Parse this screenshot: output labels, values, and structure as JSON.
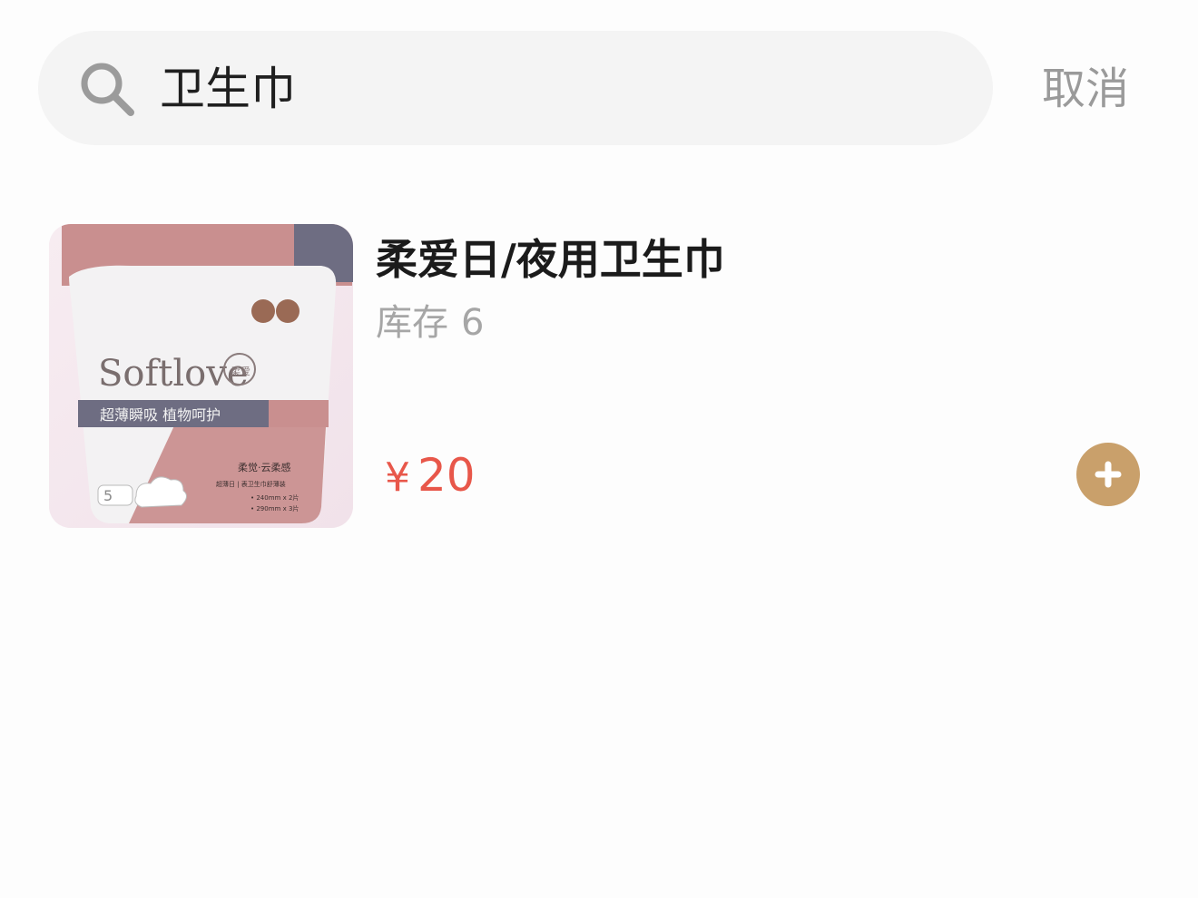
{
  "search": {
    "value": "卫生巾",
    "cancel_label": "取消"
  },
  "product": {
    "name": "柔爱日/夜用卫生巾",
    "stock_label": "库存",
    "stock_value": "6",
    "currency": "¥",
    "price": "20",
    "image_texts": {
      "brand": "Softlove",
      "brand_badge": "柔爱",
      "slogan": "超薄瞬吸 植物呵护",
      "line_name": "柔觉·云柔感",
      "spec_line": "超薄日 | 表卫生巾舒薄装",
      "spec_1": "• 240mm x 2片",
      "spec_2": "• 290mm x 3片",
      "count_badge": "5"
    }
  },
  "colors": {
    "accent_add": "#c9a06b",
    "price": "#e8574a",
    "search_bg": "#f4f4f4"
  },
  "icons": {
    "search": "search-icon",
    "add": "plus-icon"
  }
}
